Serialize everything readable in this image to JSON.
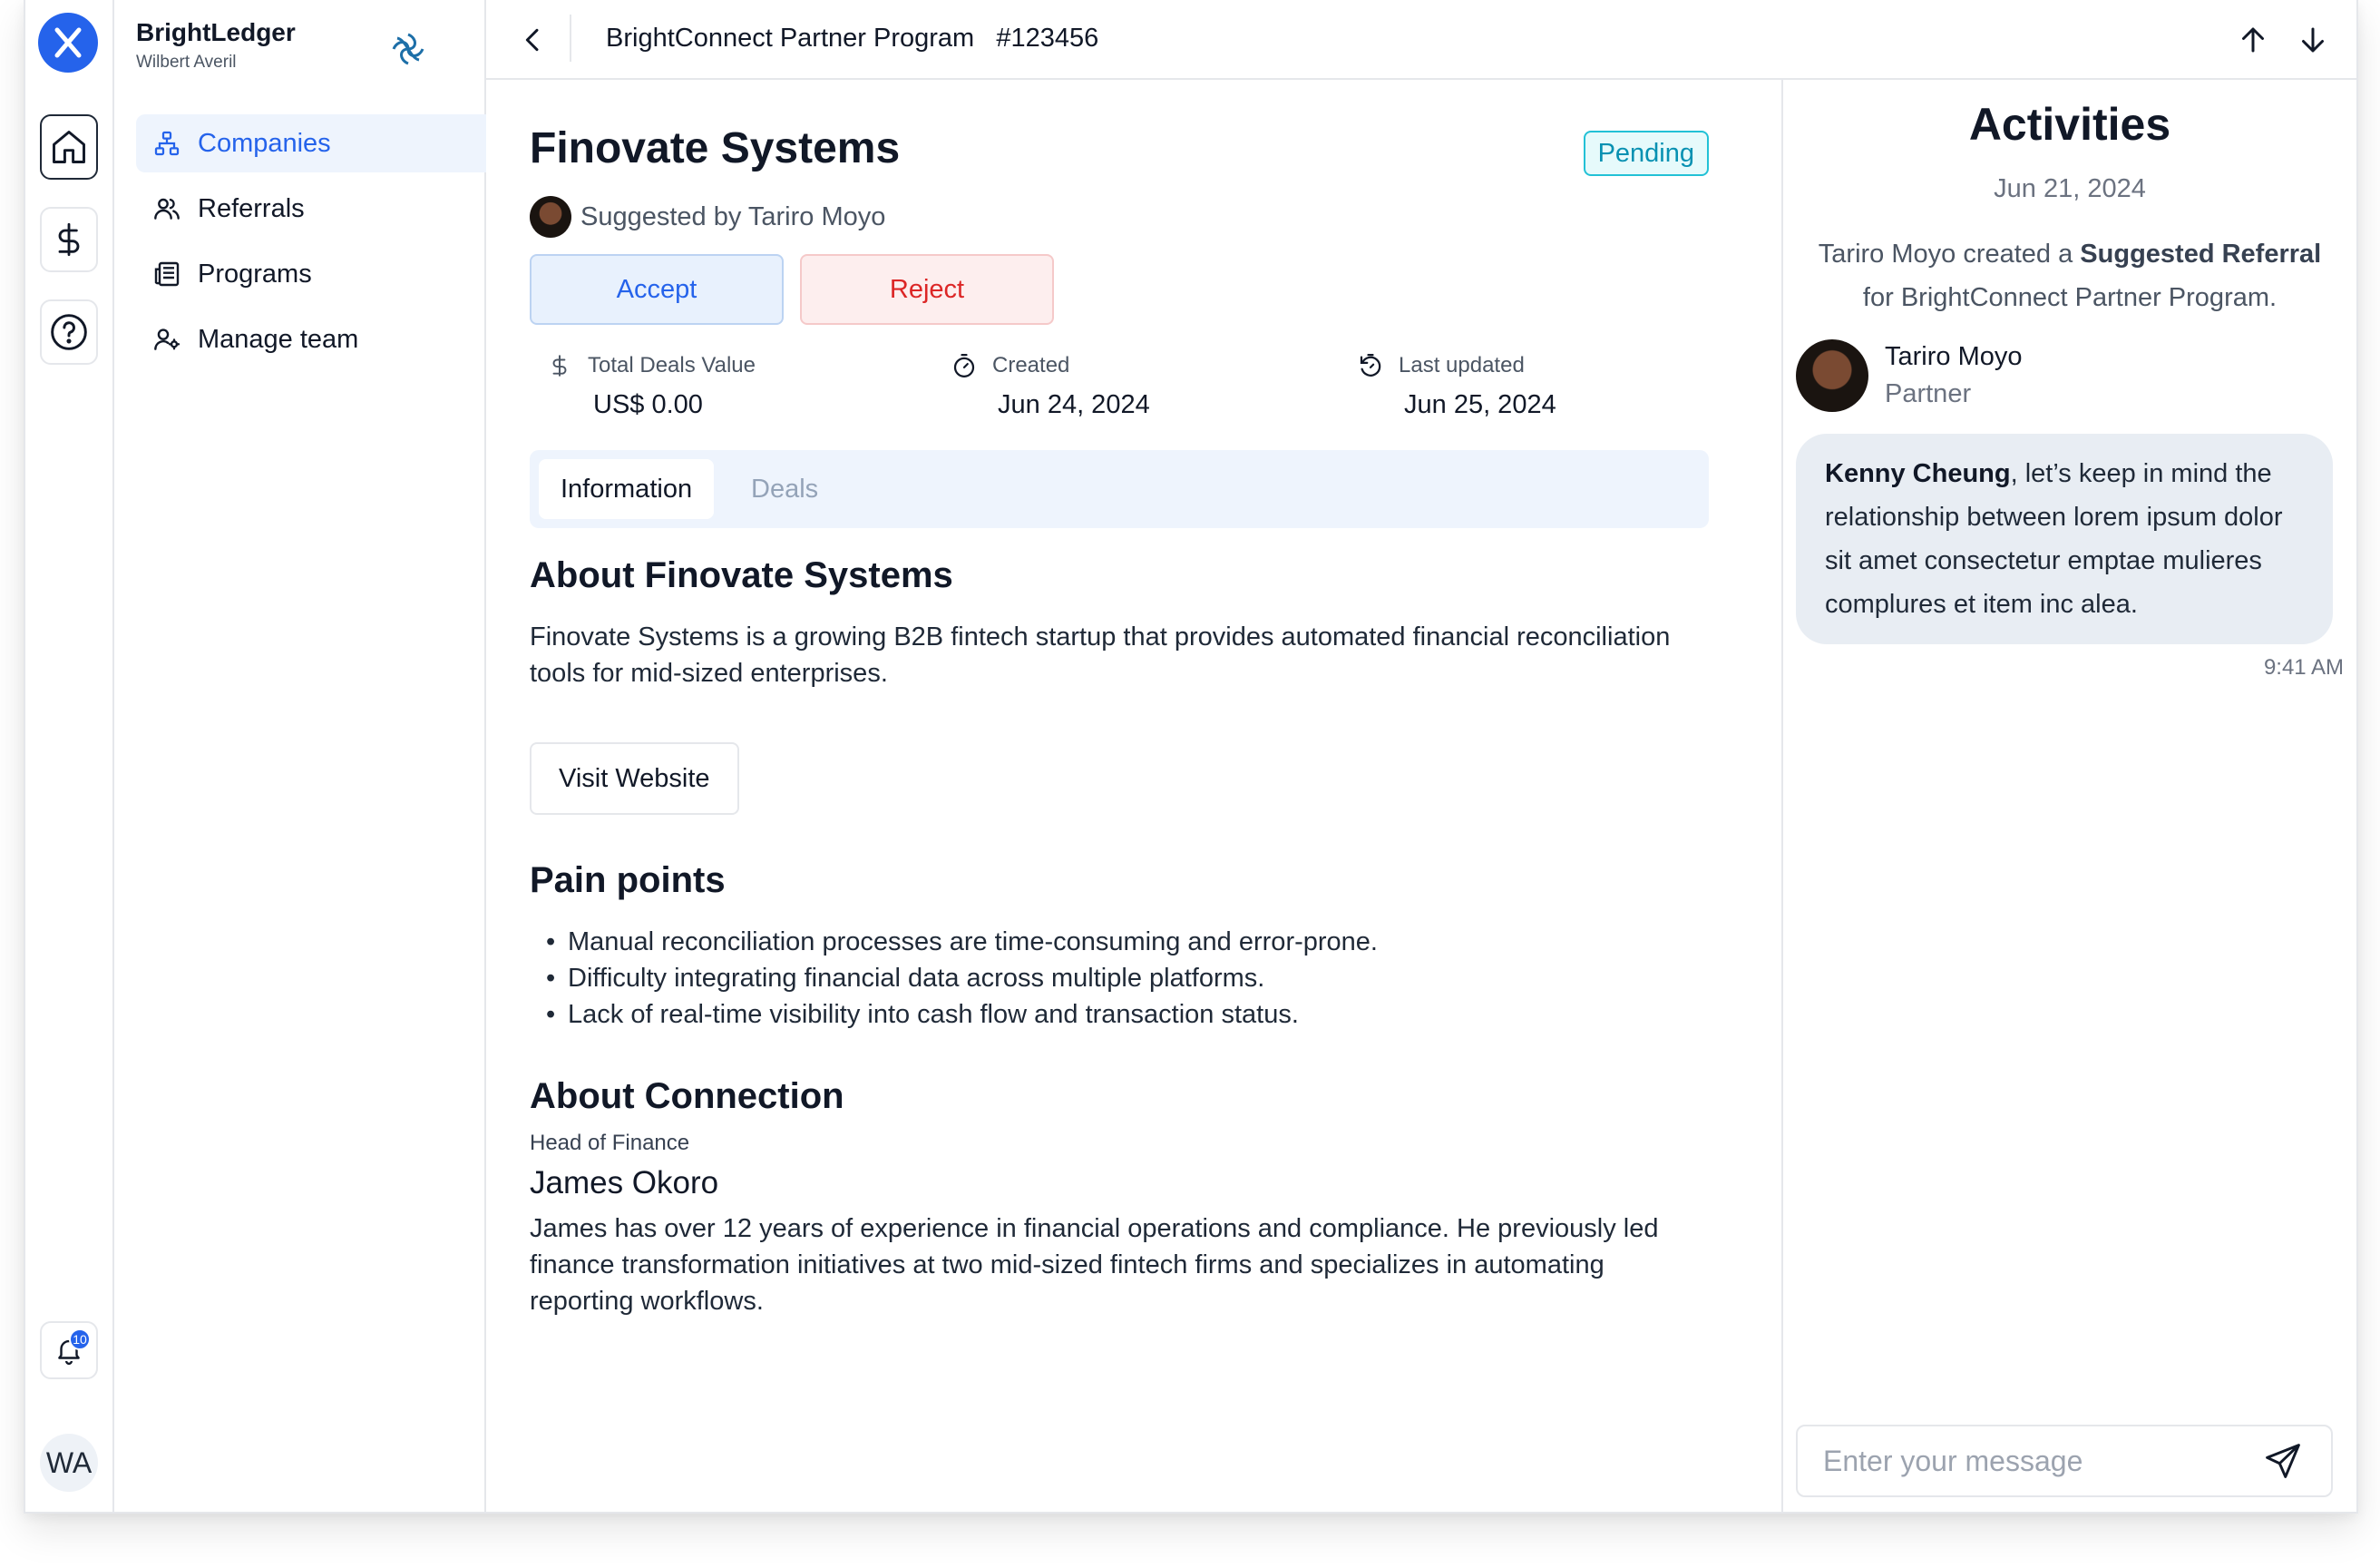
{
  "app": {
    "org_name": "BrightLedger",
    "org_user": "Wilbert Averil",
    "user_initials": "WA",
    "notifications_count": "10"
  },
  "nav": {
    "items": [
      {
        "label": "Companies",
        "icon": "org-chart-icon",
        "active": true
      },
      {
        "label": "Referrals",
        "icon": "users-icon"
      },
      {
        "label": "Programs",
        "icon": "newspaper-icon"
      },
      {
        "label": "Manage team",
        "icon": "user-cog-icon"
      }
    ]
  },
  "topbar": {
    "title": "BrightConnect Partner Program",
    "id": "#123456"
  },
  "company": {
    "name": "Finovate Systems",
    "status": "Pending",
    "suggested_by": "Suggested by Tariro Moyo",
    "accept_label": "Accept",
    "reject_label": "Reject",
    "stats": [
      {
        "label": "Total Deals Value",
        "value": "US$ 0.00"
      },
      {
        "label": "Created",
        "value": "Jun 24, 2024"
      },
      {
        "label": "Last updated",
        "value": "Jun 25, 2024"
      }
    ],
    "tabs": [
      "Information",
      "Deals"
    ],
    "about_heading": "About Finovate Systems",
    "about_text": "Finovate Systems is a growing B2B fintech startup that provides automated financial reconciliation tools for mid-sized enterprises.",
    "visit_label": "Visit Website",
    "pain_heading": "Pain points",
    "pain_points": [
      "Manual reconciliation processes are time-consuming and error-prone.",
      "Difficulty integrating financial data across multiple platforms.",
      "Lack of real-time visibility into cash flow and transaction status."
    ],
    "connection_heading": "About Connection",
    "connection_role": "Head of Finance",
    "connection_name": "James Okoro",
    "connection_bio": "James has over 12 years of experience in financial operations and compliance. He previously led finance transformation initiatives at two mid-sized fintech firms and specializes in automating reporting workflows."
  },
  "activities": {
    "title": "Activities",
    "date": "Jun 21, 2024",
    "event_pre": "Tariro Moyo created a ",
    "event_bold": "Suggested Referral",
    "event_post": " for BrightConnect Partner Program.",
    "user_name": "Tariro Moyo",
    "user_role": "Partner",
    "message_mention": "Kenny Cheung",
    "message_body": ", let’s keep in mind the relationship between lorem ipsum dolor sit amet consectetur emptae mulieres complures et item inc alea.",
    "message_time": "9:41 AM",
    "input_placeholder": "Enter your message"
  },
  "colors": {
    "accent": "#2563eb",
    "pending": "#0891b2",
    "reject": "#dc2626"
  }
}
